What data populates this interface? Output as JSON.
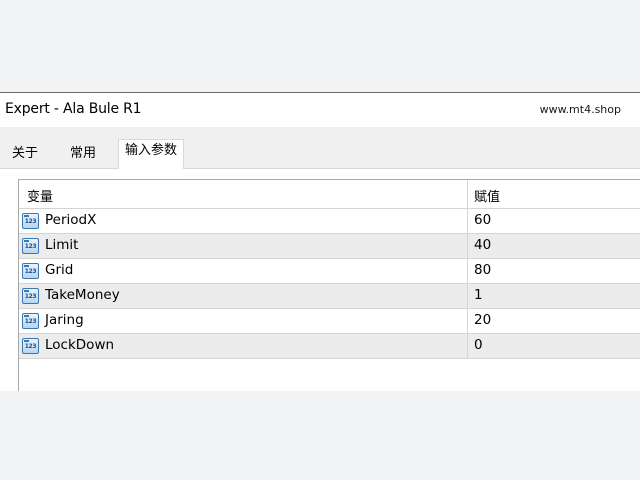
{
  "window": {
    "title": "Expert - Ala Bule R1",
    "watermark": "www.mt4.shop"
  },
  "tabs": [
    {
      "label": "关于",
      "active": false
    },
    {
      "label": "常用",
      "active": false
    },
    {
      "label": "输入参数",
      "active": true
    }
  ],
  "table": {
    "headers": {
      "variable": "变量",
      "value": "赋值"
    },
    "row_icon": "integer-param-icon",
    "row_icon_text": "123",
    "rows": [
      {
        "name": "PeriodX",
        "value": "60"
      },
      {
        "name": "Limit",
        "value": "40"
      },
      {
        "name": "Grid",
        "value": "80"
      },
      {
        "name": "TakeMoney",
        "value": "1"
      },
      {
        "name": "Jaring",
        "value": "20"
      },
      {
        "name": "LockDown",
        "value": "0"
      }
    ]
  },
  "colors": {
    "icon_blue": "#3a78b5",
    "row_alt": "#ececec",
    "grid_line": "#d5d5d5"
  }
}
